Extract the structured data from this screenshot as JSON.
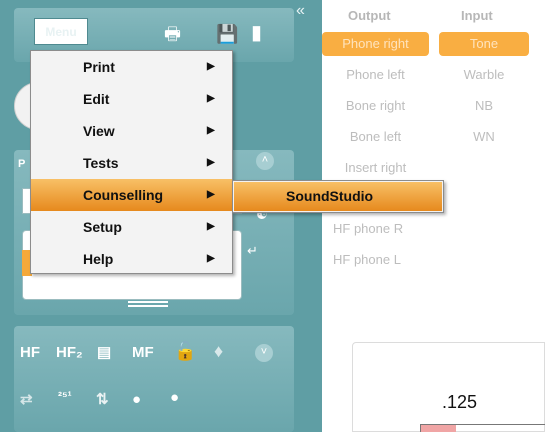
{
  "toolbar": {
    "menu_label": "Menu",
    "icons": [
      "print-icon",
      "save-icon",
      "exit-icon",
      "collapse-panel-icon"
    ]
  },
  "menu": {
    "items": [
      {
        "label": "Print",
        "has_submenu": true
      },
      {
        "label": "Edit",
        "has_submenu": true
      },
      {
        "label": "View",
        "has_submenu": true
      },
      {
        "label": "Tests",
        "has_submenu": true
      },
      {
        "label": "Counselling",
        "has_submenu": true,
        "active": true
      },
      {
        "label": "Setup",
        "has_submenu": true
      },
      {
        "label": "Help",
        "has_submenu": true
      }
    ],
    "arrow_glyph": "▶"
  },
  "submenu": {
    "items": [
      {
        "label": "SoundStudio",
        "active": true
      }
    ]
  },
  "left_panel": {
    "section_label": "P",
    "bottom_icons": {
      "hf": "HF",
      "hfz": "HF₂",
      "mf": "MF",
      "fraction": "²⁵¹"
    }
  },
  "output": {
    "header": "Output",
    "items": [
      "Phone right",
      "Phone left",
      "Bone right",
      "Bone left",
      "Insert right",
      "",
      "",
      "HF phone R",
      "HF phone L"
    ],
    "selected_index": 0
  },
  "input": {
    "header": "Input",
    "items": [
      "Tone",
      "Warble",
      "NB",
      "WN"
    ],
    "selected_index": 0
  },
  "audiogram": {
    "frequency_label": ".125"
  },
  "colors": {
    "panel_teal": "#5f9ea4",
    "selection_orange": "#f9ae42",
    "menu_highlight": "#e6891d"
  }
}
